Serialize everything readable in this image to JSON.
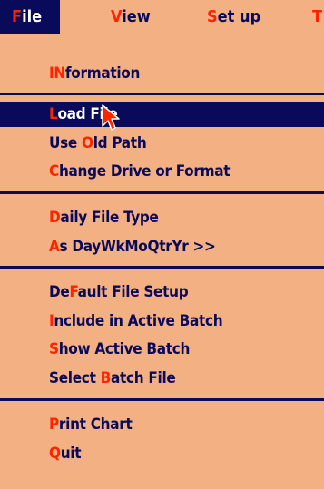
{
  "menubar": {
    "items": [
      {
        "hot": "F",
        "rest": "ile"
      },
      {
        "hot": "V",
        "rest": "iew"
      },
      {
        "hot": "S",
        "rest": "et up"
      },
      {
        "hot": "T",
        "rest": ""
      }
    ]
  },
  "menu": {
    "information": {
      "hot": "IN",
      "rest": "formation"
    },
    "load_file": {
      "pre": "",
      "hot": "L",
      "rest": "oad File"
    },
    "use_old_path": {
      "pre": "Use ",
      "hot": "O",
      "rest": "ld Path"
    },
    "change_drive": {
      "pre": "",
      "hot": "C",
      "rest": "hange Drive or Format"
    },
    "daily_file_type": {
      "pre": "",
      "hot": "D",
      "rest": "aily File Type"
    },
    "as_day": {
      "pre": "",
      "hot": "A",
      "rest": "s DayWkMoQtrYr >>"
    },
    "default_setup": {
      "pre": "De",
      "hot": "F",
      "rest": "ault File Setup"
    },
    "include_batch": {
      "pre": "",
      "hot": "I",
      "rest": "nclude in Active Batch"
    },
    "show_batch": {
      "pre": "",
      "hot": "S",
      "rest": "how Active Batch"
    },
    "select_batch": {
      "pre": "Select ",
      "hot": "B",
      "rest": "atch File"
    },
    "print_chart": {
      "pre": "",
      "hot": "P",
      "rest": "rint Chart"
    },
    "quit": {
      "pre": "",
      "hot": "Q",
      "rest": "uit"
    }
  },
  "colors": {
    "background": "#f2b083",
    "text": "#0a0a5a",
    "hotkey": "#ff2400",
    "highlight": "#0a0a5a"
  },
  "cursor_icon": "arrow-pointer-icon"
}
